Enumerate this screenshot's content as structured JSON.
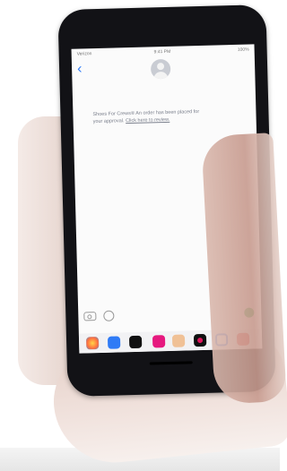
{
  "status_bar": {
    "carrier": "Verizon",
    "time": "9:41 PM",
    "battery": "100%"
  },
  "message": {
    "text": "Shoes For Crews® An order has been placed for your approval.",
    "link": "Click here to review."
  },
  "icons": {
    "back": "chevron-left-icon",
    "avatar": "contact-avatar",
    "camera": "camera-icon",
    "app_store": "app-store-icon",
    "send": "send-icon"
  }
}
